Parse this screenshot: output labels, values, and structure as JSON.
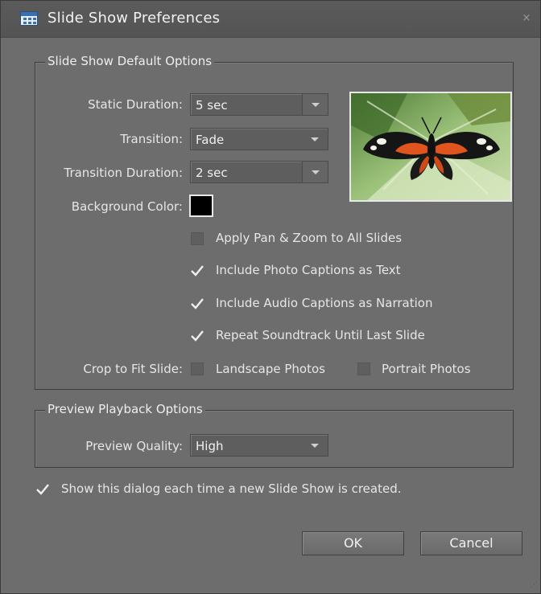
{
  "dialog": {
    "title": "Slide Show Preferences",
    "close_symbol": "×"
  },
  "default_options": {
    "group_label": "Slide Show Default Options",
    "static_duration": {
      "label": "Static Duration:",
      "value": "5 sec"
    },
    "transition": {
      "label": "Transition:",
      "value": "Fade"
    },
    "transition_duration": {
      "label": "Transition Duration:",
      "value": "2 sec"
    },
    "background_color": {
      "label": "Background Color:",
      "value": "#000000"
    },
    "checkboxes": [
      {
        "label": "Apply Pan & Zoom to All Slides",
        "checked": false
      },
      {
        "label": "Include Photo Captions as Text",
        "checked": true
      },
      {
        "label": "Include Audio Captions as Narration",
        "checked": true
      },
      {
        "label": "Repeat Soundtrack Until Last Slide",
        "checked": true
      }
    ],
    "crop_to_fit": {
      "label": "Crop to Fit Slide:",
      "landscape": {
        "label": "Landscape Photos",
        "checked": false
      },
      "portrait": {
        "label": "Portrait Photos",
        "checked": false
      }
    },
    "preview_image": "butterfly-photo"
  },
  "preview_options": {
    "group_label": "Preview Playback Options",
    "quality": {
      "label": "Preview Quality:",
      "value": "High"
    }
  },
  "show_dialog": {
    "label": "Show this dialog each time a new Slide Show is created.",
    "checked": true
  },
  "buttons": {
    "ok": "OK",
    "cancel": "Cancel"
  },
  "colors": {
    "background": "#6d6d6d",
    "text": "#e6e6e6",
    "border": "#3c3c3c"
  }
}
